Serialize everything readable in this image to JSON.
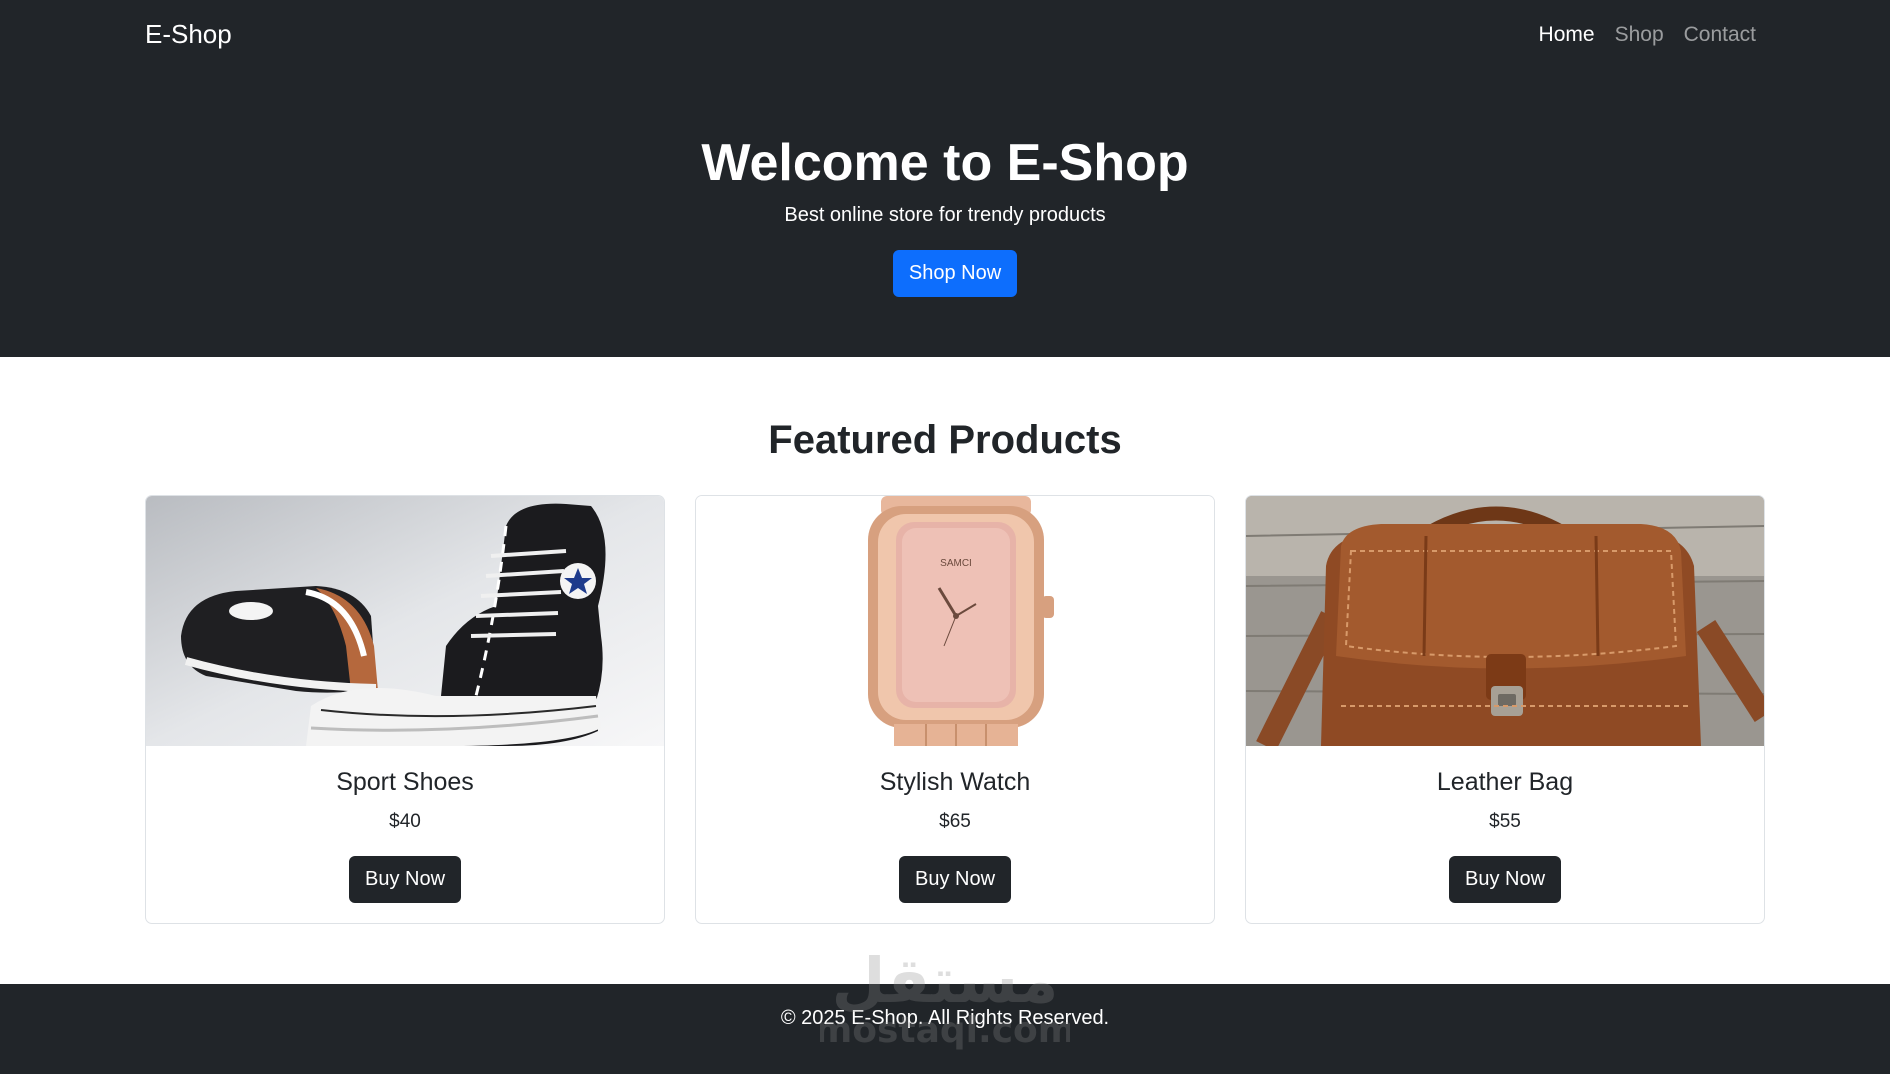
{
  "navbar": {
    "brand": "E-Shop",
    "links": [
      {
        "label": "Home",
        "active": true
      },
      {
        "label": "Shop",
        "active": false
      },
      {
        "label": "Contact",
        "active": false
      }
    ]
  },
  "hero": {
    "title": "Welcome to E-Shop",
    "subtitle": "Best online store for trendy products",
    "button_label": "Shop Now",
    "button_color": "#0d6efd"
  },
  "featured": {
    "title": "Featured Products",
    "products": [
      {
        "name": "Sport Shoes",
        "price": "$40",
        "button_label": "Buy Now",
        "image_icon": "sneaker-image"
      },
      {
        "name": "Stylish Watch",
        "price": "$65",
        "button_label": "Buy Now",
        "image_icon": "watch-image"
      },
      {
        "name": "Leather Bag",
        "price": "$55",
        "button_label": "Buy Now",
        "image_icon": "leather-bag-image"
      }
    ]
  },
  "footer": {
    "text": "© 2025 E-Shop. All Rights Reserved."
  },
  "watermark": {
    "script_text": "مستقل",
    "domain_text": "mostaql.com"
  },
  "colors": {
    "dark": "#212529",
    "primary": "#0d6efd",
    "white": "#ffffff"
  }
}
